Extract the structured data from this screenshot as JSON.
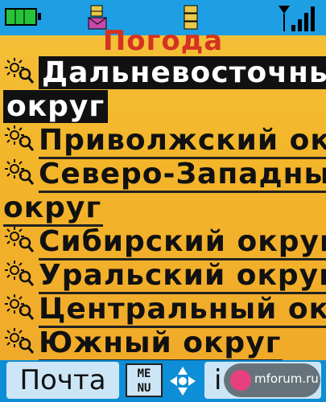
{
  "header": {
    "title": "Погода",
    "icons": [
      "battery-icon",
      "mail-icon",
      "memory-icon",
      "signal-icon"
    ]
  },
  "list": {
    "item_icon": "sun-search-icon",
    "items": [
      {
        "lines": [
          "Дальневосточный",
          "округ"
        ],
        "selected": true
      },
      {
        "lines": [
          "Приволжский округ"
        ],
        "selected": false
      },
      {
        "lines": [
          "Северо-Западный",
          "округ"
        ],
        "selected": false
      },
      {
        "lines": [
          "Сибирский округ"
        ],
        "selected": false
      },
      {
        "lines": [
          "Уральский округ"
        ],
        "selected": false
      },
      {
        "lines": [
          "Центральный округ"
        ],
        "selected": false
      },
      {
        "lines": [
          "Южный округ"
        ],
        "selected": false
      }
    ]
  },
  "softkeys": {
    "left": "Почта",
    "menu_top": "ME",
    "menu_bottom": "NU",
    "right": "i"
  },
  "watermark": {
    "text": "mforum.ru"
  },
  "colors": {
    "background": "#f3b52a",
    "status_bar": "#1f9fe3",
    "title": "#d43322",
    "selected_bg": "#111111",
    "selected_fg": "#ffffff",
    "softbar": "#0e8ed6"
  }
}
